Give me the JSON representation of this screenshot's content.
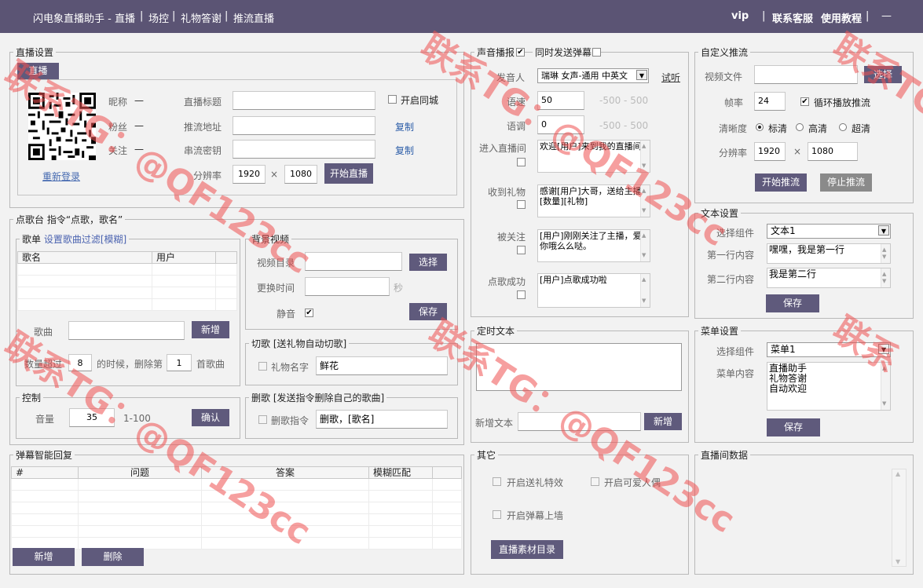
{
  "titlebar": {
    "app_title": "闪电象直播助手 - 直播",
    "nav": [
      "场控",
      "礼物答谢",
      "推流直播"
    ],
    "vip": "vip",
    "support": "联系客服",
    "tutorial": "使用教程",
    "minimize": "—"
  },
  "live": {
    "section": "直播设置",
    "tab": "直播",
    "nickname_label": "昵称",
    "nickname_value": "—",
    "fans_label": "粉丝",
    "fans_value": "—",
    "follow_label": "关注",
    "follow_value": "—",
    "relogin": "重新登录",
    "title_label": "直播标题",
    "url_label": "推流地址",
    "key_label": "串流密钥",
    "resolution_label": "分辨率",
    "res_w": "1920",
    "res_x": "×",
    "res_h": "1080",
    "start_btn": "开始直播",
    "same_city": "开启同城",
    "copy1": "复制",
    "copy2": "复制"
  },
  "song": {
    "section": "点歌台  指令“点歌，歌名”",
    "list_title": "歌单",
    "filter_link": "设置歌曲过滤[模糊]",
    "col_name": "歌名",
    "col_user": "用户",
    "song_label": "歌曲",
    "add_btn": "新增",
    "exceed_pre": "数量超过",
    "exceed_val": "8",
    "exceed_mid": "的时候，删除第",
    "delete_val": "1",
    "exceed_post": "首歌曲"
  },
  "control": {
    "section": "控制",
    "volume_label": "音量",
    "volume_val": "35",
    "range": "1-100",
    "confirm_btn": "确认"
  },
  "bgvideo": {
    "section": "背景视频",
    "dir_label": "视频目录",
    "select_btn": "选择",
    "change_label": "更换时间",
    "sec": "秒",
    "mute_label": "静音",
    "mute_check": "✔",
    "save_btn": "保存"
  },
  "cut": {
    "section": "切歌 [送礼物自动切歌]",
    "gift_label": "礼物名字",
    "gift_val": "鲜花"
  },
  "delsong": {
    "section": "删歌 [发送指令删除自己的歌曲]",
    "cmd_label": "删歌指令",
    "cmd_val": "删歌，[歌名]"
  },
  "danmu": {
    "section": "弹幕智能回复",
    "cols": [
      "#",
      "问题",
      "答案",
      "模糊匹配"
    ],
    "add_btn": "新增",
    "delete_btn": "删除"
  },
  "voice": {
    "section": "声音播报",
    "section_check": "✔",
    "sync_label": "同时发送弹幕",
    "speaker_label": "发音人",
    "speaker_val": "瑞琳 女声-通用 中英文",
    "listen": "试听",
    "speed_label": "语速",
    "speed_val": "50",
    "speed_range": "-500 - 500",
    "pitch_label": "语调",
    "pitch_val": "0",
    "pitch_range": "-500 - 500",
    "enter_label": "进入直播间",
    "enter_text": "欢迎[用户]来到我的直播间",
    "gift_label": "收到礼物",
    "gift_text": "感谢[用户]大哥，送给主播[数量][礼物]",
    "follow_label": "被关注",
    "follow_text": "[用户]刚刚关注了主播，爱你哦么么哒。",
    "song_label": "点歌成功",
    "song_text": "[用户]点歌成功啦"
  },
  "timer": {
    "section": "定时文本",
    "new_label": "新增文本",
    "add_btn": "新增"
  },
  "other": {
    "section": "其它",
    "gift_fx": "开启送礼特效",
    "cute_doll": "开启可爱人偶",
    "wall": "开启弹幕上墙",
    "material_btn": "直播素材目录"
  },
  "push": {
    "section": "自定义推流",
    "file_label": "视频文件",
    "select_btn": "选择",
    "fps_label": "帧率",
    "fps_val": "24",
    "loop_label": "循环播放推流",
    "loop_check": "✔",
    "clarity_label": "清晰度",
    "opt_std": "标清",
    "opt_high": "高清",
    "opt_ultra": "超清",
    "res_label": "分辨率",
    "res_w": "1920",
    "res_x": "×",
    "res_h": "1080",
    "start_btn": "开始推流",
    "stop_btn": "停止推流"
  },
  "text_settings": {
    "section": "文本设置",
    "component_label": "选择组件",
    "component_val": "文本1",
    "line1_label": "第一行内容",
    "line1_val": "嘿嘿，我是第一行",
    "line2_label": "第二行内容",
    "line2_val": "我是第二行",
    "save_btn": "保存"
  },
  "menu_settings": {
    "section": "菜单设置",
    "component_label": "选择组件",
    "component_val": "菜单1",
    "content_label": "菜单内容",
    "content_val": "直播助手\n礼物答谢\n自动欢迎",
    "save_btn": "保存"
  },
  "room_data": {
    "section": "直播间数据"
  },
  "watermark": {
    "text1": "联系TG：@QF123cc",
    "text2": "联系TG：@QF123cc",
    "text3": "联系TG：@QF123cc",
    "text4": "联系TG：@QF123cc",
    "text5": "联系TG：@QF123cc",
    "text6": "联系"
  },
  "colors": {
    "titlebar": "#5b5474",
    "button": "#5f5a7c",
    "watermark": "#ee5050"
  }
}
